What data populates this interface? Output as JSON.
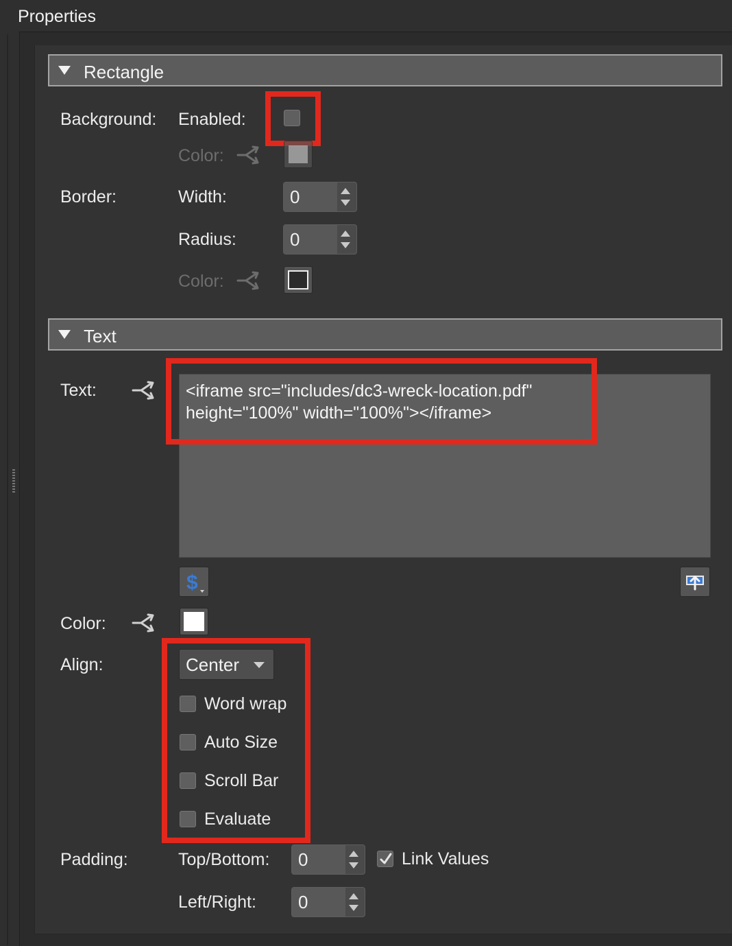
{
  "panel": {
    "title": "Properties"
  },
  "rectangle": {
    "header": "Rectangle",
    "background_label": "Background:",
    "enabled_label": "Enabled:",
    "enabled_checked": false,
    "bg_color_label": "Color:",
    "bg_color": "#c2c2c2",
    "border_label": "Border:",
    "width_label": "Width:",
    "width_value": "0",
    "radius_label": "Radius:",
    "radius_value": "0",
    "border_color_label": "Color:",
    "border_color": "#2b2b2b"
  },
  "text": {
    "header": "Text",
    "text_label": "Text:",
    "text_content": "<iframe src=\"includes/dc3-wreck-location.pdf\"\nheight=\"100%\" width=\"100%\"></iframe>",
    "color_label": "Color:",
    "color_value": "#ffffff",
    "align_label": "Align:",
    "align_value": "Center",
    "options": [
      {
        "label": "Word wrap",
        "checked": false
      },
      {
        "label": "Auto Size",
        "checked": false
      },
      {
        "label": "Scroll Bar",
        "checked": false
      },
      {
        "label": "Evaluate",
        "checked": false
      }
    ],
    "padding_label": "Padding:",
    "topbottom_label": "Top/Bottom:",
    "topbottom_value": "0",
    "leftright_label": "Left/Right:",
    "leftright_value": "0",
    "link_values_label": "Link Values",
    "link_values_checked": true
  },
  "icons": {
    "link": "share-link-icon",
    "dollar": "dollar-icon",
    "insert": "insert-icon",
    "checkmark": "checkmark-icon"
  },
  "colors": {
    "highlight": "#e2281d",
    "dollar_blue": "#3a7bd5"
  }
}
